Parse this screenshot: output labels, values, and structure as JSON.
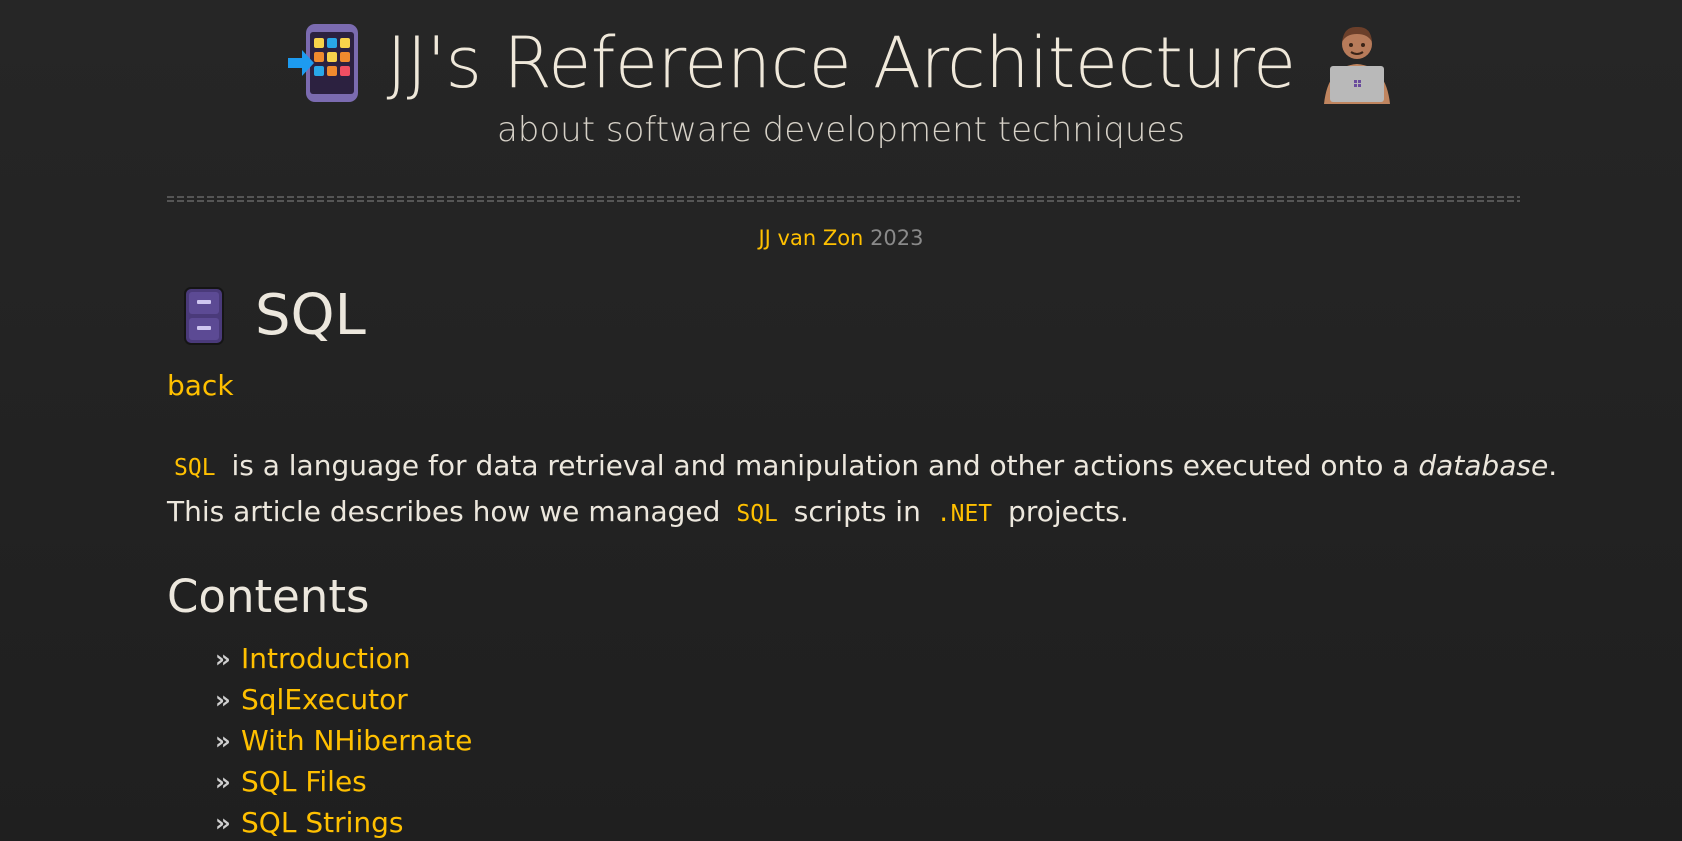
{
  "site": {
    "title": "JJ's Reference Architecture",
    "subtitle": "about software development techniques",
    "logo_icon": "app-grid-icon",
    "dev_icon": "technologist-laptop-icon"
  },
  "byline": {
    "author": "JJ van Zon",
    "year": "2023"
  },
  "article": {
    "icon": "file-cabinet-icon",
    "title": "SQL",
    "back_label": "back",
    "intro": {
      "line1": {
        "code": "SQL",
        "text": "is a language for data retrieval and manipulation and other actions executed onto a",
        "emphasis": "database",
        "end": "."
      },
      "line2": {
        "text1": "This article describes how we managed",
        "code1": "SQL",
        "text2": "scripts in",
        "code2": ".NET",
        "text3": "projects."
      }
    },
    "contents_heading": "Contents",
    "toc": [
      {
        "label": "Introduction"
      },
      {
        "label": "SqlExecutor"
      },
      {
        "label": "With NHibernate"
      },
      {
        "label": "SQL Files"
      },
      {
        "label": "SQL Strings"
      }
    ]
  },
  "colors": {
    "background": "#232323",
    "text": "#ece7dd",
    "accent": "#ffc000",
    "muted": "#8a8a8a"
  }
}
